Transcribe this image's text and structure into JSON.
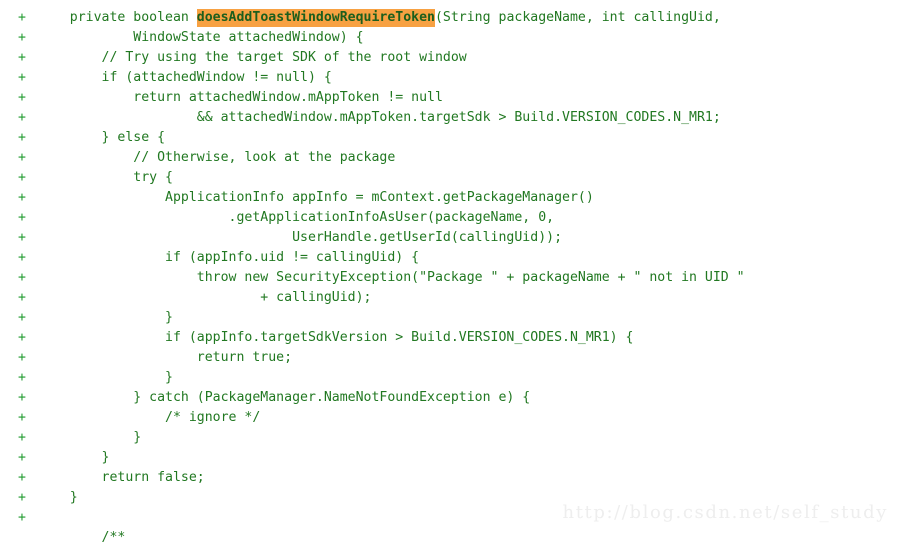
{
  "document": {
    "type": "code-diff",
    "language": "java",
    "background_color": "#ffffff",
    "added_line_color": "#217821",
    "marker_color": "#1f9a2e",
    "highlight_background": "#f7a142",
    "highlight_text_color": "#1c5e1c",
    "line_marker": "+"
  },
  "highlight": {
    "token": "doesAddToastWindowRequireToken",
    "line_index": 0,
    "prefix": "    private boolean ",
    "suffix": "(String packageName, int callingUid,"
  },
  "lines": [
    {
      "marker": "+",
      "text": "    private boolean doesAddToastWindowRequireToken(String packageName, int callingUid,"
    },
    {
      "marker": "+",
      "text": "            WindowState attachedWindow) {"
    },
    {
      "marker": "+",
      "text": "        // Try using the target SDK of the root window"
    },
    {
      "marker": "+",
      "text": "        if (attachedWindow != null) {"
    },
    {
      "marker": "+",
      "text": "            return attachedWindow.mAppToken != null"
    },
    {
      "marker": "+",
      "text": "                    && attachedWindow.mAppToken.targetSdk > Build.VERSION_CODES.N_MR1;"
    },
    {
      "marker": "+",
      "text": "        } else {"
    },
    {
      "marker": "+",
      "text": "            // Otherwise, look at the package"
    },
    {
      "marker": "+",
      "text": "            try {"
    },
    {
      "marker": "+",
      "text": "                ApplicationInfo appInfo = mContext.getPackageManager()"
    },
    {
      "marker": "+",
      "text": "                        .getApplicationInfoAsUser(packageName, 0,"
    },
    {
      "marker": "+",
      "text": "                                UserHandle.getUserId(callingUid));"
    },
    {
      "marker": "+",
      "text": "                if (appInfo.uid != callingUid) {"
    },
    {
      "marker": "+",
      "text": "                    throw new SecurityException(\"Package \" + packageName + \" not in UID \""
    },
    {
      "marker": "+",
      "text": "                            + callingUid);"
    },
    {
      "marker": "+",
      "text": "                }"
    },
    {
      "marker": "+",
      "text": "                if (appInfo.targetSdkVersion > Build.VERSION_CODES.N_MR1) {"
    },
    {
      "marker": "+",
      "text": "                    return true;"
    },
    {
      "marker": "+",
      "text": "                }"
    },
    {
      "marker": "+",
      "text": "            } catch (PackageManager.NameNotFoundException e) {"
    },
    {
      "marker": "+",
      "text": "                /* ignore */"
    },
    {
      "marker": "+",
      "text": "            }"
    },
    {
      "marker": "+",
      "text": "        }"
    },
    {
      "marker": "+",
      "text": "        return false;"
    },
    {
      "marker": "+",
      "text": "    }"
    },
    {
      "marker": "+",
      "text": ""
    },
    {
      "marker": "",
      "text": "        /**"
    }
  ],
  "watermark": {
    "text": "http://blog.csdn.net/self_study"
  }
}
